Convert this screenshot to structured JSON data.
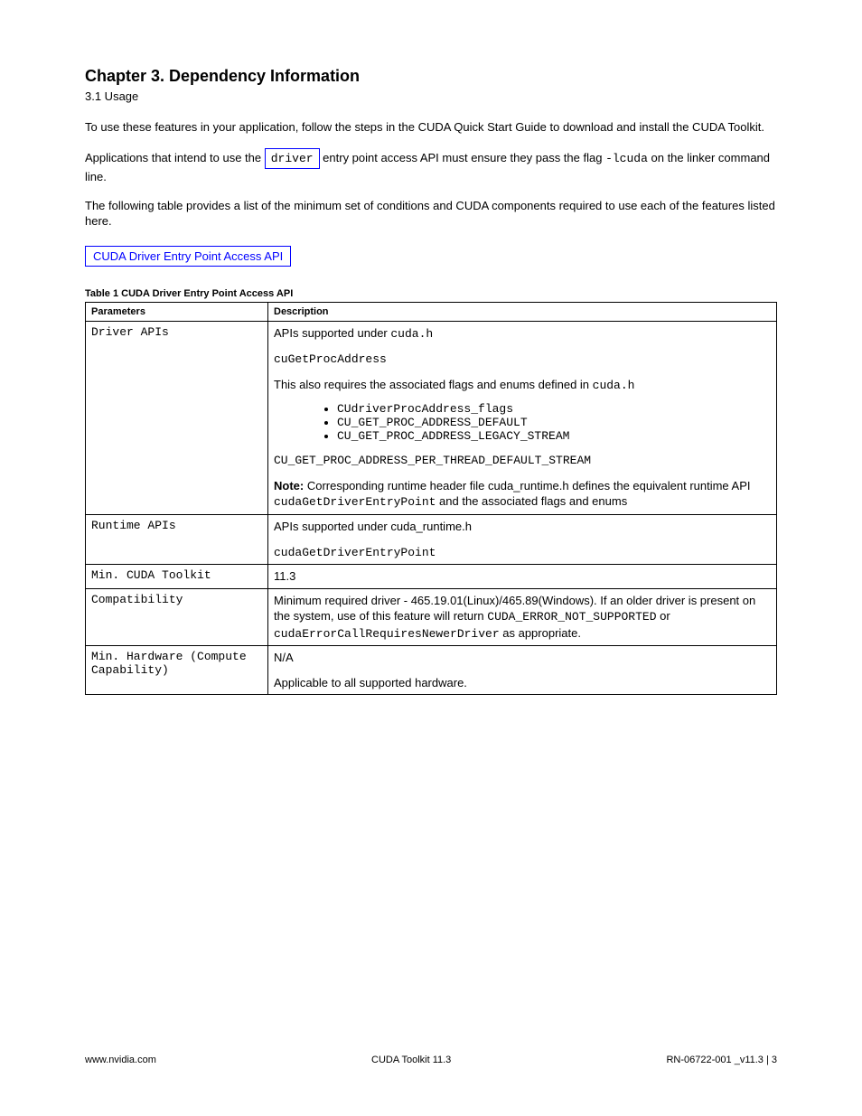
{
  "heading": {
    "title": "Chapter 3.  Dependency Information",
    "sub": "3.1  Usage"
  },
  "paragraphs": {
    "p1_prefix": "To use these features in your application, follow the steps in the ",
    "p1_link": "CUDA Quick Start Guide",
    "p1_suffix": " to download and install the CUDA Toolkit.",
    "p2_prefix": "Applications that intend to use the ",
    "p2_code": "driver",
    "p2_mid": " entry point access API must ensure they pass the flag ",
    "p2_flag": "-lcuda",
    "p2_suffix": " on the linker command line.",
    "p3": "The following table provides a list of the minimum set of conditions and CUDA components required to use each of the features listed here.",
    "feature_link": "CUDA Driver Entry Point Access API"
  },
  "table": {
    "title": "Table 1 CUDA Driver Entry Point Access API",
    "headers": {
      "param": "Parameters",
      "desc": "Description"
    },
    "rows": [
      {
        "label": "Driver APIs",
        "paragraphs": [
          "APIs supported under <span class=\"mono\">cuda.h</span>",
          "<span class=\"mono\">cuGetProcAddress</span>",
          "This also requires the associated flags and enums defined in <span class=\"mono\">cuda.h</span>"
        ],
        "list": [
          "CUdriverProcAddress_flags",
          "CU_GET_PROC_ADDRESS_DEFAULT",
          "CU_GET_PROC_ADDRESS_LEGACY_STREAM"
        ],
        "trailing": [
          "<span class=\"mono\">CU_GET_PROC_ADDRESS_PER_THREAD_DEFAULT_STREAM</span>",
          "<span class=\"note-label\">Note:</span> Corresponding runtime header file cuda_runtime.h defines the equivalent runtime API <span class=\"mono\">cudaGetDriverEntryPoint</span> and the associated flags and enums"
        ]
      },
      {
        "label": "Runtime APIs",
        "paragraphs": [
          "APIs supported under cuda_runtime.h",
          "<span class=\"mono\">cudaGetDriverEntryPoint</span>"
        ]
      },
      {
        "label": "Min. CUDA Toolkit",
        "paragraphs": [
          "11.3"
        ]
      },
      {
        "label": "Compatibility",
        "paragraphs": [
          "Minimum required driver - 465.19.01(Linux)/465.89(Windows). If an older driver is present on the system, use of this feature will return <span class=\"mono\">CUDA_ERROR_NOT_SUPPORTED</span> or <span class=\"mono\">cudaErrorCallRequiresNewerDriver</span> as appropriate."
        ]
      },
      {
        "label": "Min. Hardware (Compute Capability)",
        "paragraphs": [
          "N/A",
          "Applicable to all supported hardware."
        ]
      }
    ]
  },
  "footer": {
    "left": "www.nvidia.com",
    "center": "CUDA Toolkit 11.3",
    "right": "RN-06722-001 _v11.3   |   3"
  }
}
